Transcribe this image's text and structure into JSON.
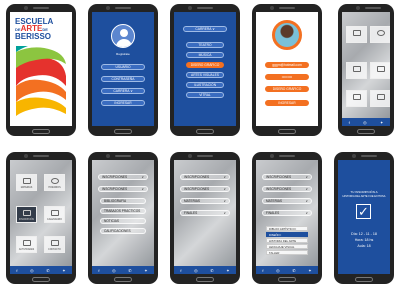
{
  "logo": {
    "line1": "ESCUELA",
    "line2": "DE",
    "line3": "ARTE",
    "line4": "DE",
    "line5": "BERISSO"
  },
  "register": {
    "label": "Registrate",
    "items": [
      "USUARIO",
      "CONTRASEÑA",
      "CARRERA ∨",
      "INGRESAR"
    ]
  },
  "careers": {
    "dropdown": "CARRERA ∨",
    "items": [
      "TEATRO",
      "MÚSICA",
      "DISEÑO GRÁFICO",
      "ARTES VISUALES",
      "ILUSTRACIÓN",
      "VITRAL"
    ]
  },
  "profile": {
    "email": "gggrn@hotmail.com",
    "password": "•••••••••",
    "career": "DISEÑO GRÁFICO",
    "submit": "INGRESAR"
  },
  "grid": {
    "tiles": [
      "MATERIAS",
      "HORARIOS",
      "INSCRIPCIÓN",
      "CALENDARIO",
      "ACTIVIDADES",
      "CONTACTO"
    ]
  },
  "menu1": {
    "items": [
      "INSCRIPCIONES",
      "INSCRIPCIONES",
      "BIBLIOGRAFÍA",
      "TRABAJOS PRÁCTICOS",
      "NOTICIAS",
      "CALIFICACIONES"
    ]
  },
  "menu2": {
    "items": [
      "INSCRIPCIONES",
      "INSCRIPCIONES",
      "MATERIAS",
      "FINALES"
    ]
  },
  "menu3": {
    "items": [
      "INSCRIPCIONES",
      "INSCRIPCIONES",
      "MATERIAS",
      "FINALES"
    ],
    "subs": [
      "DIBUJO ARTÍSTICO I",
      "DISEÑO I",
      "HISTORIA DEL ARTE",
      "LENGUAJE VISUAL",
      "TALLER"
    ]
  },
  "confirm": {
    "title1": "TU INSCRIPCIÓN A",
    "title2": "HISTORIA DEL ARTE FUE EXITOSA",
    "date": "Día: 12 - 11 - 18",
    "time": "Hora: 18 hs",
    "room": "Aula: 18"
  },
  "colors": {
    "blue": "#1e4f9e",
    "orange": "#f37021"
  }
}
